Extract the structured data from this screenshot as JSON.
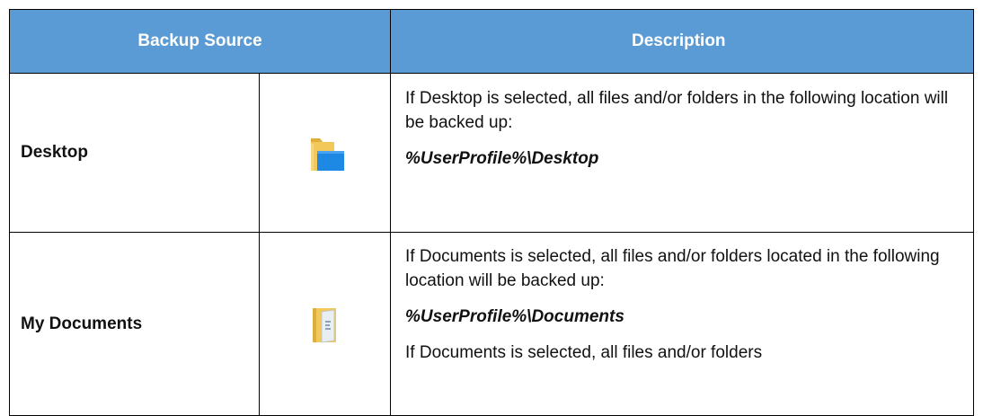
{
  "table": {
    "headers": {
      "backup_source": "Backup Source",
      "description": "Description"
    },
    "rows": [
      {
        "source": "Desktop",
        "icon": "desktop-folder-icon",
        "description": "If Desktop is selected, all files and/or folders in the following location will be backed up:",
        "path": "%UserProfile%\\Desktop",
        "extra": ""
      },
      {
        "source": "My Documents",
        "icon": "documents-folder-icon",
        "description": "If Documents is selected, all files and/or folders located in the following location will be backed up:",
        "path": "%UserProfile%\\Documents",
        "extra": "If Documents is selected, all files and/or folders"
      }
    ]
  },
  "colors": {
    "header_bg": "#5b9bd5",
    "header_text": "#ffffff",
    "folder_yellow": "#f2c85b",
    "desktop_blue": "#1e88e5"
  }
}
